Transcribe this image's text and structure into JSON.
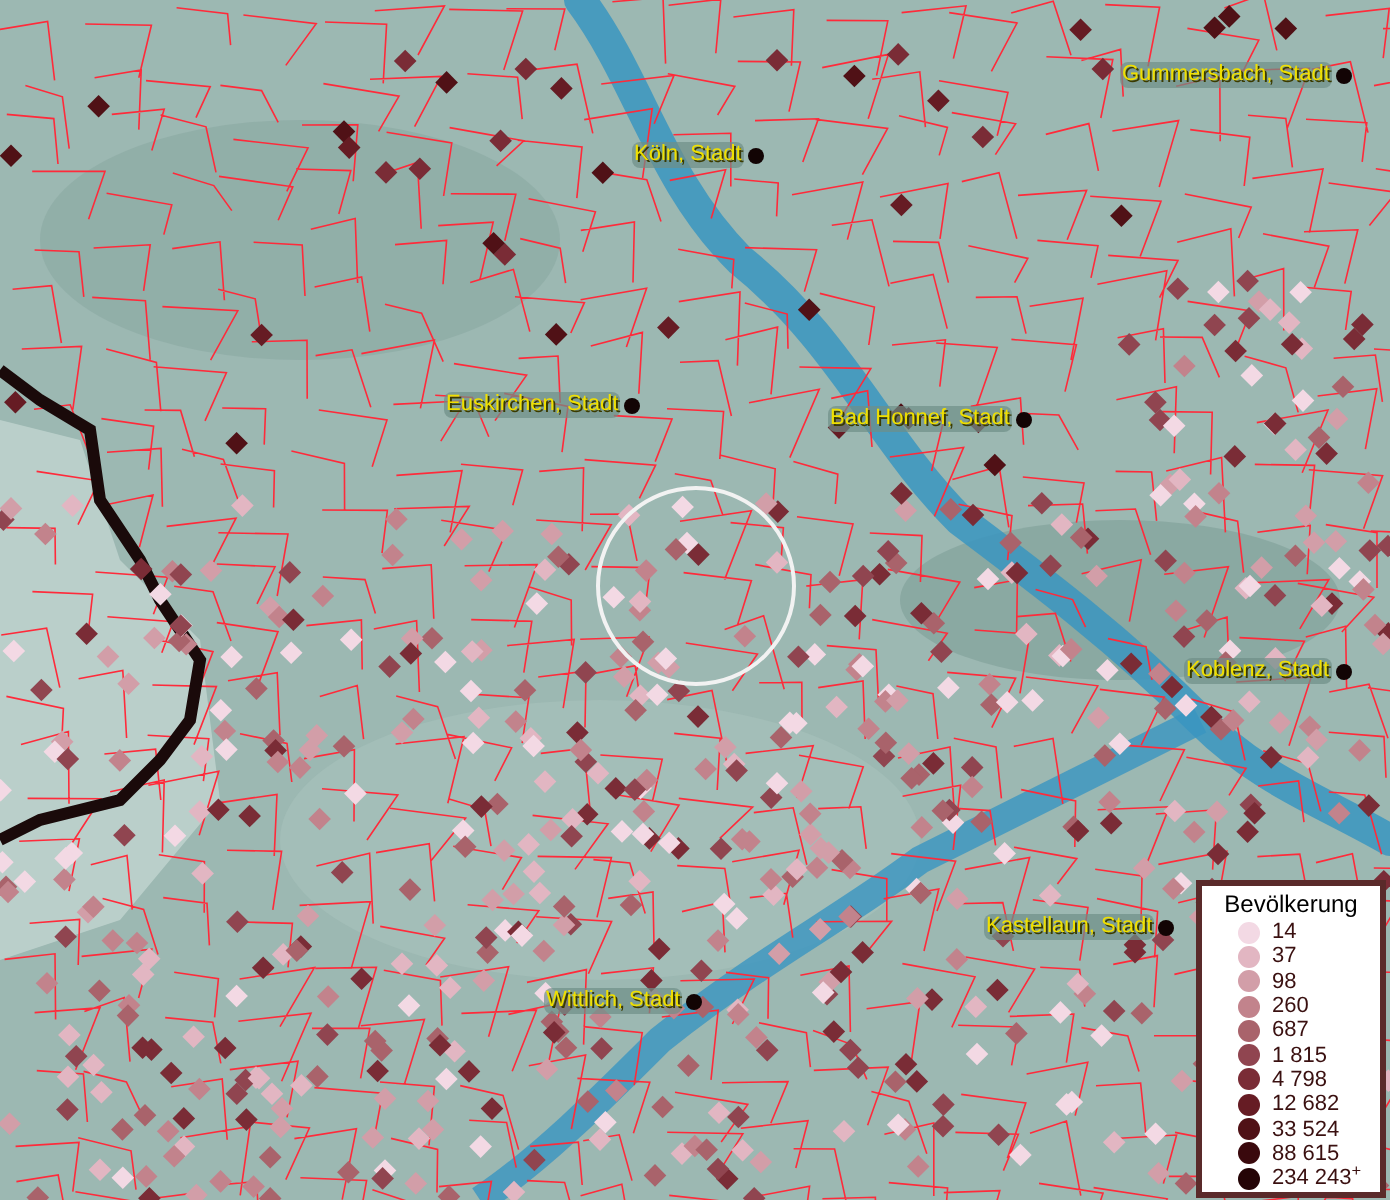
{
  "map": {
    "places": [
      {
        "label": "Gummersbach, Stadt"
      },
      {
        "label": "Köln, Stadt"
      },
      {
        "label": "Euskirchen, Stadt"
      },
      {
        "label": "Bad Honnef, Stadt"
      },
      {
        "label": "Koblenz, Stadt"
      },
      {
        "label": "Kastellaun, Stadt"
      },
      {
        "label": "Wittlich, Stadt"
      }
    ]
  },
  "legend": {
    "title": "Bevölkerung",
    "items": [
      {
        "label": "14",
        "color": "#f3d9e4"
      },
      {
        "label": "37",
        "color": "#e2b6c2"
      },
      {
        "label": "98",
        "color": "#d29ea8"
      },
      {
        "label": "260",
        "color": "#c2838c"
      },
      {
        "label": "687",
        "color": "#a9636b"
      },
      {
        "label": "1 815",
        "color": "#904550"
      },
      {
        "label": "4 798",
        "color": "#7a2c36"
      },
      {
        "label": "12 682",
        "color": "#661c24"
      },
      {
        "label": "33 524",
        "color": "#501116"
      },
      {
        "label": "88 615",
        "color": "#3a090d"
      },
      {
        "label": "234 243$^{+}$",
        "color": "#240406"
      }
    ]
  }
}
